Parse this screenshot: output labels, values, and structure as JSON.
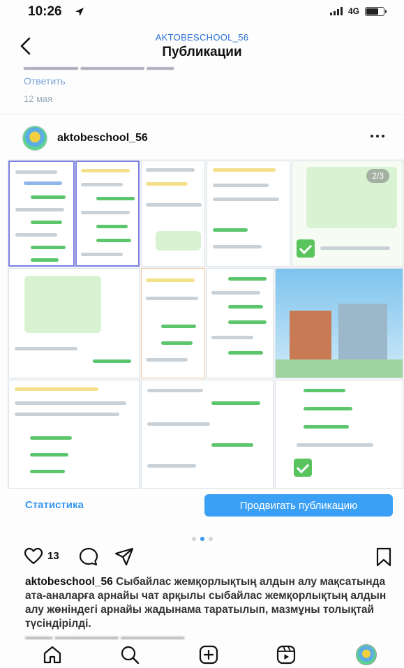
{
  "status_bar": {
    "time": "10:26",
    "network": "4G",
    "icons": [
      "location-arrow-icon",
      "signal-icon",
      "battery-icon"
    ]
  },
  "navbar": {
    "account": "AKTOBESCHOOL_56",
    "title": "Публикации",
    "back_icon": "chevron-left-icon"
  },
  "previous_comment": {
    "text": "Ответить",
    "date": "12 мая"
  },
  "post": {
    "username": "aktobeschool_56",
    "more_icon": "ellipsis-icon",
    "page_indicator": "2/3",
    "carousel": {
      "total": 3,
      "current": 2
    },
    "statistics_label": "Статистика",
    "promote_label": "Продвигать публикацию",
    "likes": "13",
    "caption_user": "aktobeschool_56",
    "caption_text": "Сыбайлас жемқорлықтың алдын алу мақсатында ата-аналарға арнайы чат арқылы сыбайлас жемқорлықтың алдын алу жөніндегі арнайы жадынама таратылып, мазмұны толықтай түсіндірілді."
  },
  "tab_bar": {
    "items": [
      "home-icon",
      "search-icon",
      "create-post-icon",
      "reels-icon",
      "profile-avatar"
    ]
  },
  "colors": {
    "accent": "#3897f0",
    "promote_button": "#3aa0f5",
    "link": "#2a6fd6"
  }
}
